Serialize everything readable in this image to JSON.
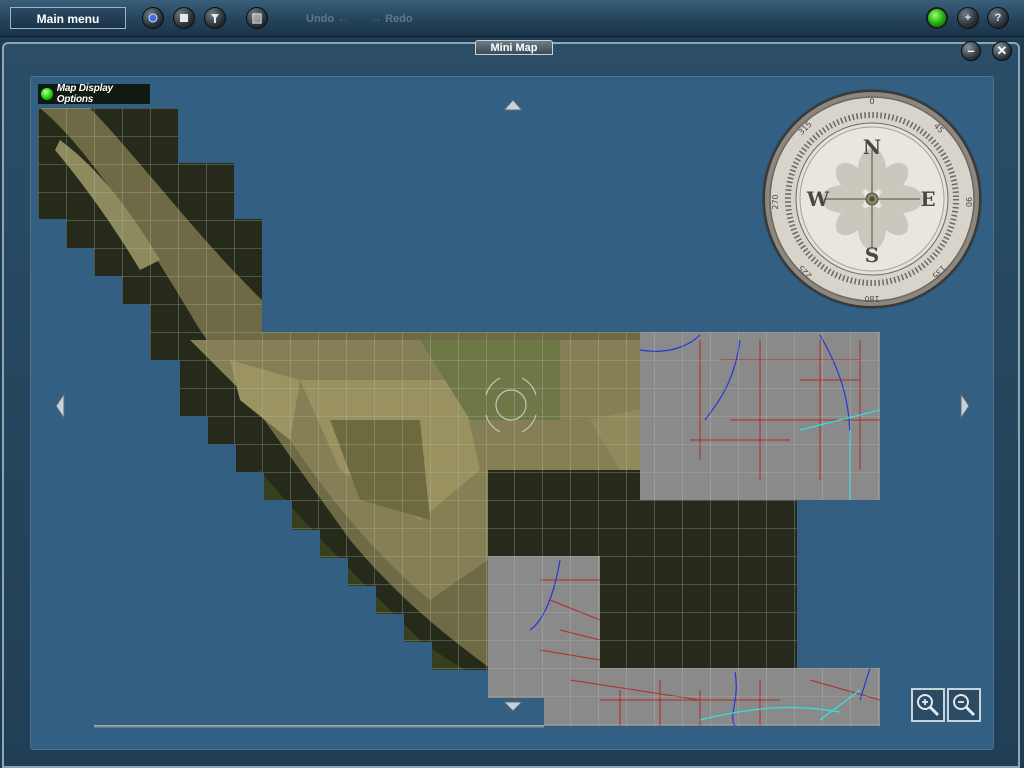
{
  "toolbar": {
    "main_menu_label": "Main menu",
    "undo_label": "Undo",
    "redo_label": "Redo",
    "buttons": [
      {
        "name": "camera-icon"
      },
      {
        "name": "stop-icon"
      },
      {
        "name": "query-tool-icon"
      },
      {
        "name": "trash-icon"
      }
    ],
    "right_buttons": [
      {
        "name": "status-light-icon"
      },
      {
        "name": "add-icon",
        "symbol": "+"
      },
      {
        "name": "help-icon",
        "symbol": "?"
      }
    ]
  },
  "window": {
    "title": "Mini Map",
    "minimize_symbol": "–",
    "close_symbol": "✕"
  },
  "map": {
    "options_label": "Map Display Options",
    "compass": {
      "letters": [
        "N",
        "E",
        "S",
        "W"
      ],
      "degree_labels": [
        "0",
        "45",
        "90",
        "135",
        "180",
        "225",
        "270",
        "315"
      ]
    },
    "zoom_in_icon": "zoom-in-icon",
    "zoom_out_icon": "zoom-out-icon"
  },
  "colors": {
    "sea": "#335f82",
    "land_dark": "#252a1a",
    "land_fields": "#8a8a5a",
    "urban": "#8a8a8a",
    "grid": "#b8c3b0",
    "roads": "#b12a2a",
    "rivers": "#2636d8",
    "railways": "#34e0e0",
    "forest": "#55591f"
  }
}
